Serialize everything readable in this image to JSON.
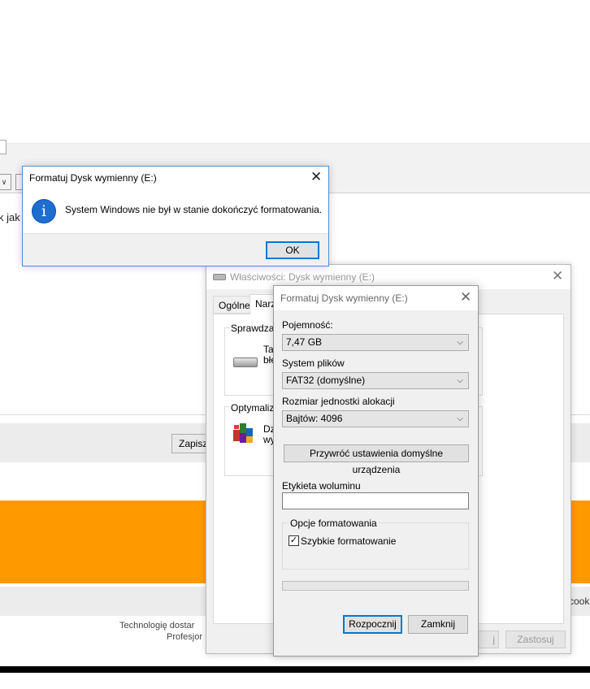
{
  "background": {
    "partial_text_left": "k jak",
    "save_button_partial": "Zapisz",
    "cookie_partial": "cook",
    "footer_line_1": "Technologię dostar",
    "footer_line_2": "Profesjor",
    "orange_color": "#ff9900"
  },
  "properties_dialog": {
    "title": "Właściwości: Dysk wymienny (E:)",
    "tabs": [
      "Ogólne",
      "Narz"
    ],
    "group_check": {
      "label": "Sprawdzan",
      "text_1": "Ta",
      "text_2": "błę"
    },
    "group_optimize": {
      "label": "Optymalizo",
      "text_1": "Dz",
      "text_2": "wy"
    },
    "ok_partial": "j",
    "apply_button": "Zastosuj"
  },
  "format_dialog": {
    "title": "Formatuj Dysk wymienny (E:)",
    "capacity_label": "Pojemność:",
    "capacity_value": "7,47 GB",
    "filesystem_label": "System plików",
    "filesystem_value": "FAT32 (domyślne)",
    "allocation_label": "Rozmiar jednostki alokacji",
    "allocation_value": "Bajtów: 4096",
    "restore_defaults_button": "Przywróć ustawienia domyślne urządzenia",
    "volume_label_label": "Etykieta woluminu",
    "volume_label_value": "",
    "options_group_label": "Opcje formatowania",
    "quick_format_label": "Szybkie formatowanie",
    "quick_format_checked": true,
    "start_button": "Rozpocznij",
    "close_button": "Zamknij"
  },
  "message_box": {
    "title": "Formatuj Dysk wymienny (E:)",
    "message": "System Windows nie był w stanie dokończyć formatowania.",
    "ok_button": "OK",
    "accent_color": "#0078d7"
  }
}
